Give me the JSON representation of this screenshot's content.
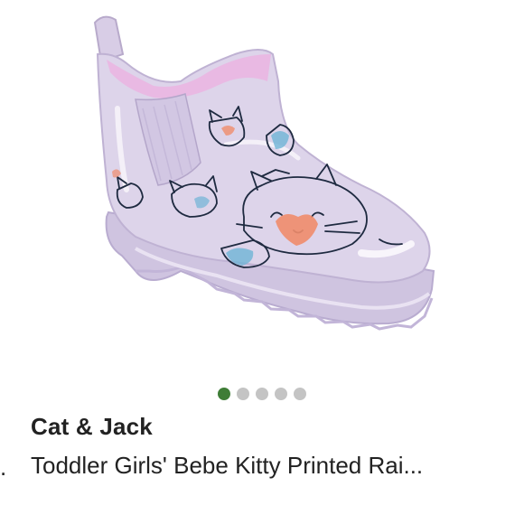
{
  "product": {
    "brand": "Cat & Jack",
    "title": "Toddler Girls' Bebe Kitty Printed Rai...",
    "bullet": ".",
    "image_icon": "rain-boot-image"
  },
  "carousel": {
    "total_images": 5,
    "active_index": 0,
    "active_color": "#3f7d36",
    "inactive_color": "#c4c4c4"
  },
  "colors": {
    "boot_body": "#ddd4ea",
    "boot_lining": "#e9b9e3",
    "print_outline": "#1e2a40",
    "print_blue": "#6fb4d6",
    "print_orange": "#f08c6c"
  }
}
